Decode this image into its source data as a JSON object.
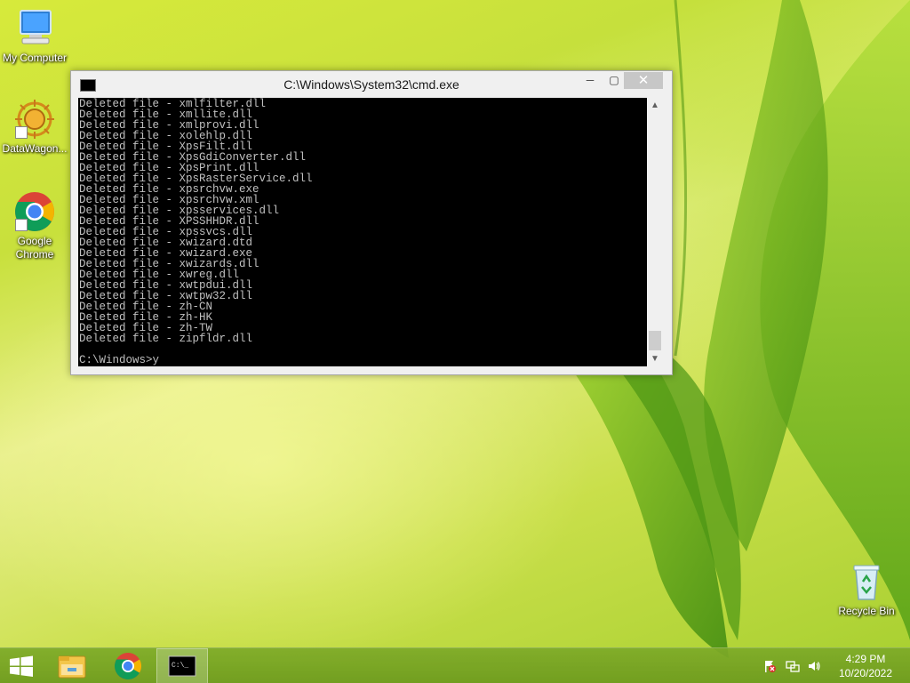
{
  "desktop": {
    "icons": [
      {
        "label": "My Computer"
      },
      {
        "label": "DataWagon..."
      },
      {
        "label": "Google Chrome"
      },
      {
        "label": "Recycle Bin"
      }
    ]
  },
  "cmd_window": {
    "title": "C:\\Windows\\System32\\cmd.exe",
    "lines": [
      "Deleted file - xmlfilter.dll",
      "Deleted file - xmllite.dll",
      "Deleted file - xmlprovi.dll",
      "Deleted file - xolehlp.dll",
      "Deleted file - XpsFilt.dll",
      "Deleted file - XpsGdiConverter.dll",
      "Deleted file - XpsPrint.dll",
      "Deleted file - XpsRasterService.dll",
      "Deleted file - xpsrchvw.exe",
      "Deleted file - xpsrchvw.xml",
      "Deleted file - xpsservices.dll",
      "Deleted file - XPSSHHDR.dll",
      "Deleted file - xpssvcs.dll",
      "Deleted file - xwizard.dtd",
      "Deleted file - xwizard.exe",
      "Deleted file - xwizards.dll",
      "Deleted file - xwreg.dll",
      "Deleted file - xwtpdui.dll",
      "Deleted file - xwtpw32.dll",
      "Deleted file - zh-CN",
      "Deleted file - zh-HK",
      "Deleted file - zh-TW",
      "Deleted file - zipfldr.dll"
    ],
    "prompt": "C:\\Windows>y",
    "buttons": {
      "minimize": "─",
      "maximize": "▢",
      "close": "✕"
    },
    "scroll_up": "▲",
    "scroll_down": "▼"
  },
  "taskbar": {
    "clock_time": "4:29 PM",
    "clock_date": "10/20/2022",
    "cmd_icon_text": "C:\\_"
  },
  "colors": {
    "console_bg": "#000000",
    "console_text": "#c0c0c0",
    "taskbar": "#7aa828"
  }
}
